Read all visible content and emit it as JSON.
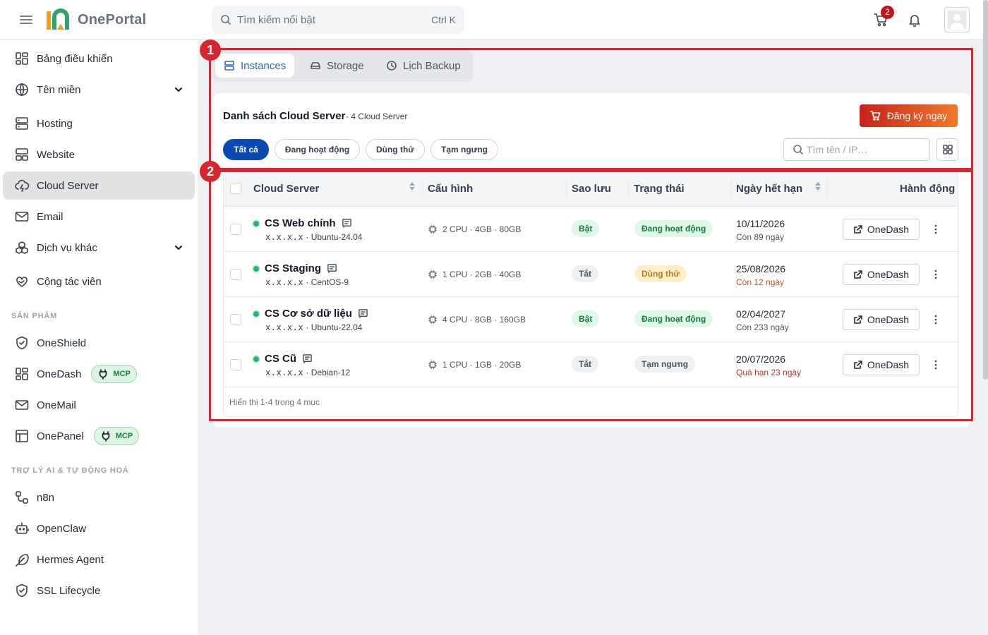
{
  "header": {
    "brand": "OnePortal",
    "search_placeholder": "Tìm kiếm nổi bật",
    "search_shortcut": "Ctrl K",
    "cart_count": "2"
  },
  "sidebar": {
    "items": [
      {
        "label": "Bảng điều khiển",
        "icon": "dashboard-icon"
      },
      {
        "label": "Tên miền",
        "icon": "globe-icon",
        "expandable": true
      },
      {
        "label": "Hosting",
        "icon": "server-icon"
      },
      {
        "label": "Website",
        "icon": "website-icon"
      },
      {
        "label": "Cloud Server",
        "icon": "cloud-server-icon",
        "active": true
      },
      {
        "label": "Email",
        "icon": "mail-icon"
      },
      {
        "label": "Dịch vụ khác",
        "icon": "boxes-icon",
        "expandable": true
      },
      {
        "label": "Cộng tác viên",
        "icon": "handshake-heart-icon"
      }
    ],
    "section_products": "SẢN PHẨM",
    "products": [
      {
        "label": "OneShield",
        "icon": "shield-icon"
      },
      {
        "label": "OneDash",
        "icon": "dashboard-icon",
        "badge": "MCP"
      },
      {
        "label": "OneMail",
        "icon": "mail-icon"
      },
      {
        "label": "OnePanel",
        "icon": "panel-icon",
        "badge": "MCP"
      }
    ],
    "section_ai": "TRỢ LÝ AI & TỰ ĐỘNG HOÁ",
    "ai": [
      {
        "label": "n8n",
        "icon": "workflow-icon"
      },
      {
        "label": "OpenClaw",
        "icon": "robot-icon"
      },
      {
        "label": "Hermes Agent",
        "icon": "feather-icon"
      },
      {
        "label": "SSL Lifecycle",
        "icon": "shield-check-icon"
      }
    ]
  },
  "tabs": [
    {
      "label": "Instances",
      "active": true
    },
    {
      "label": "Storage"
    },
    {
      "label": "Lịch Backup"
    }
  ],
  "card": {
    "title": "Danh sách Cloud Server",
    "count": "· 4 Cloud Server",
    "cta": "Đăng ký ngay",
    "filters": [
      "Tất cả",
      "Đang hoạt động",
      "Dùng thử",
      "Tạm ngưng"
    ],
    "search_placeholder": "Tìm tên / IP…"
  },
  "table": {
    "columns": [
      "Cloud Server",
      "Cấu hình",
      "Sao lưu",
      "Trạng thái",
      "Ngày hết hạn",
      "Hành động"
    ],
    "rows": [
      {
        "name": "CS Web chính",
        "ip": "x.x.x.x",
        "os": "Ubuntu-24.04",
        "config": "2 CPU · 4GB · 80GB",
        "backup": "Bật",
        "status": "Đang hoạt động",
        "expiry": "10/11/2026",
        "remaining": "Còn 89 ngày",
        "action": "OneDash"
      },
      {
        "name": "CS Staging",
        "ip": "x.x.x.x",
        "os": "CentOS-9",
        "config": "1 CPU · 2GB · 40GB",
        "backup": "Tắt",
        "status": "Dùng thử",
        "expiry": "25/08/2026",
        "remaining": "Còn 12 ngày",
        "action": "OneDash"
      },
      {
        "name": "CS Cơ sở dữ liệu",
        "ip": "x.x.x.x",
        "os": "Ubuntu-22.04",
        "config": "4 CPU · 8GB · 160GB",
        "backup": "Bật",
        "status": "Đang hoạt động",
        "expiry": "02/04/2027",
        "remaining": "Còn 233 ngày",
        "action": "OneDash"
      },
      {
        "name": "CS Cũ",
        "ip": "x.x.x.x",
        "os": "Debian-12",
        "config": "1 CPU · 1GB · 20GB",
        "backup": "Tắt",
        "status": "Tạm ngưng",
        "expiry": "20/07/2026",
        "remaining": "Quá hạn 23 ngày",
        "action": "OneDash"
      }
    ],
    "footer": "Hiển thị 1-4 trong 4 mục"
  },
  "annotations": [
    "1",
    "2"
  ],
  "colors": {
    "accent": "#2f66d6",
    "primary_filter": "#0a49b4",
    "cta_start": "#c9201c",
    "cta_end": "#f07a2a",
    "annotation": "#d7262e",
    "warn_text": "#c05621",
    "overdue_text": "#c53030"
  }
}
